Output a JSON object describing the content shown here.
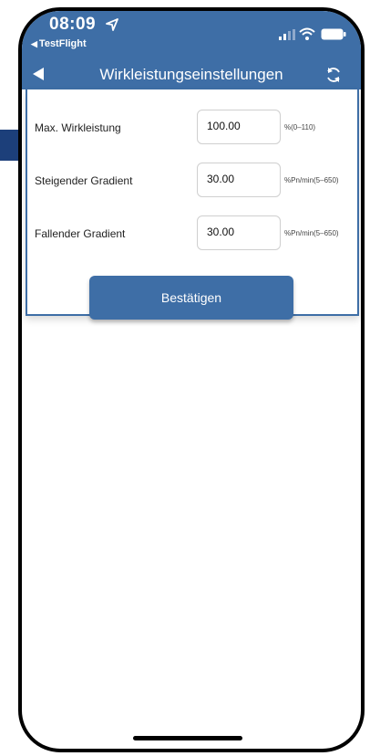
{
  "status_bar": {
    "time": "08:09",
    "back_app": "TestFlight"
  },
  "nav": {
    "title": "Wirkleistungseinstellungen"
  },
  "form": {
    "rows": [
      {
        "label": "Max. Wirkleistung",
        "value": "100.00",
        "unit": "%(0–110)"
      },
      {
        "label": "Steigender Gradient",
        "value": "30.00",
        "unit": "%Pn/min(5–650)"
      },
      {
        "label": "Fallender Gradient",
        "value": "30.00",
        "unit": "%Pn/min(5–650)"
      }
    ],
    "confirm_label": "Bestätigen"
  },
  "colors": {
    "accent": "#3e6ea6",
    "annotation_arrow": "#1c3f7a"
  },
  "icons": [
    "location-arrow-icon",
    "back-triangle-icon",
    "signal-icon",
    "wifi-icon",
    "battery-icon",
    "back-arrow-icon",
    "refresh-icon",
    "annotation-arrow-icon"
  ]
}
